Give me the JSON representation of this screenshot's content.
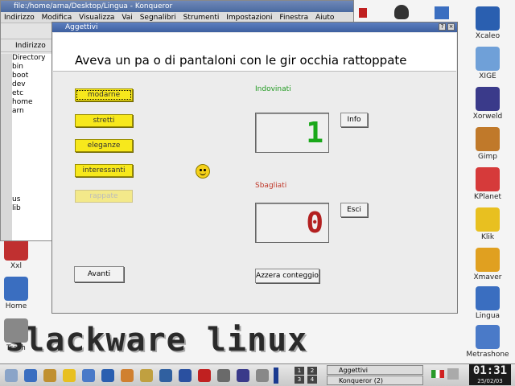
{
  "wallpaper": {
    "text": "slackware linux"
  },
  "konqueror": {
    "title": "file:/home/arna/Desktop/Lingua - Konqueror",
    "menu": [
      "Indirizzo",
      "Modifica",
      "Visualizza",
      "Vai",
      "Segnalibri",
      "Strumenti",
      "Impostazioni",
      "Finestra",
      "Aiuto"
    ],
    "location_label": "Indirizzo",
    "tree": [
      "Directory",
      "bin",
      "boot",
      "dev",
      "etc",
      "home",
      "arn",
      "",
      "",
      "",
      "",
      "",
      "",
      "",
      "",
      "",
      "us",
      "lib"
    ]
  },
  "dialog": {
    "title": "Aggettivi",
    "phrase": "Aveva un pa o di pantaloni con le gir occhia rattoppate",
    "options": [
      {
        "label": "modarne",
        "state": "selected"
      },
      {
        "label": "stretti",
        "state": "normal"
      },
      {
        "label": "eleganze",
        "state": "normal"
      },
      {
        "label": "interessanti",
        "state": "normal"
      },
      {
        "label": "rappate",
        "state": "faded"
      }
    ],
    "correct_label": "Indovinati",
    "correct_value": "1",
    "wrong_label": "Sbagliati",
    "wrong_value": "0",
    "info_button": "Info",
    "exit_button": "Esci",
    "next_button": "Avanti",
    "reset_button": "Azzera conteggio"
  },
  "desktop_icons": [
    {
      "label": "Xcaleo",
      "color": "#2a5fb0"
    },
    {
      "label": "XIGE",
      "color": "#6fa0d8"
    },
    {
      "label": "Xorweld",
      "color": "#3a3a8a"
    },
    {
      "label": "Gimp",
      "color": "#c0792a"
    },
    {
      "label": "KPlanet",
      "color": "#d63a3a"
    },
    {
      "label": "Klik",
      "color": "#e8c020"
    },
    {
      "label": "Xmaver",
      "color": "#e0a020"
    },
    {
      "label": "Lingua",
      "color": "#3a6ec0"
    },
    {
      "label": "Metrashone",
      "color": "#4a7ac8"
    },
    {
      "label": "Xxl",
      "color": "#c03030"
    },
    {
      "label": "Home",
      "color": "#3a6ec0"
    },
    {
      "label": "Trash",
      "color": "#888888"
    }
  ],
  "taskbar": {
    "tasks": [
      "Aggettivi",
      "Konqueror (2)"
    ],
    "pager": [
      "1",
      "2",
      "3",
      "4"
    ],
    "clock_time": "01:31",
    "clock_date": "25/02/03"
  }
}
